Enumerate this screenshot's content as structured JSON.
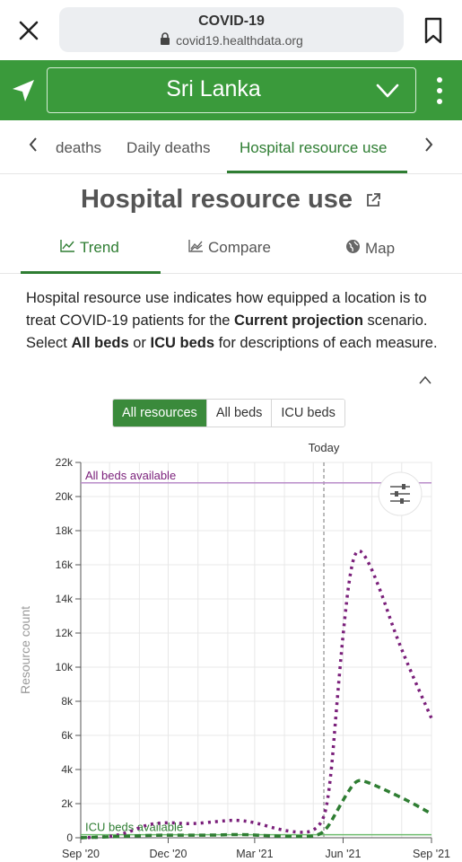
{
  "browser": {
    "title": "COVID-19",
    "url": "covid19.healthdata.org"
  },
  "header": {
    "country": "Sri Lanka"
  },
  "tabs": {
    "items": [
      "deaths",
      "Daily deaths",
      "Hospital resource use"
    ],
    "active": "Hospital resource use"
  },
  "page": {
    "title": "Hospital resource use"
  },
  "subtabs": {
    "trend": "Trend",
    "compare": "Compare",
    "map": "Map"
  },
  "description": {
    "part1": "Hospital resource use indicates how equipped a location is to treat COVID-19 patients for the ",
    "bold1": "Current projection",
    "part2": " scenario. Select ",
    "bold2": "All beds",
    "part3": " or ",
    "bold3": "ICU beds",
    "part4": " for descriptions of each measure."
  },
  "filters": {
    "options": [
      "All resources",
      "All beds",
      "ICU beds"
    ],
    "selected": "All resources"
  },
  "colors": {
    "brand_green": "#3a9a3b",
    "all_beds": "#7a1f7a",
    "icu_beds": "#2e7d32",
    "all_beds_line": "#b98cc9",
    "icu_line": "#6dbb6d"
  },
  "chart_data": {
    "type": "line",
    "ylabel": "Resource count",
    "today_label": "Today",
    "x_ticks": [
      "Sep '20",
      "Dec '20",
      "Mar '21",
      "Jun '21",
      "Sep '21"
    ],
    "x_tick_dates": [
      "2020-09-01",
      "2020-12-01",
      "2021-03-01",
      "2021-06-01",
      "2021-09-01"
    ],
    "today": "2021-05-12",
    "ylim": [
      0,
      22000
    ],
    "y_ticks": [
      0,
      2000,
      4000,
      6000,
      8000,
      10000,
      12000,
      14000,
      16000,
      18000,
      20000,
      22000
    ],
    "y_tick_labels": [
      "0",
      "2k",
      "4k",
      "6k",
      "8k",
      "10k",
      "12k",
      "14k",
      "16k",
      "18k",
      "20k",
      "22k"
    ],
    "grid": true,
    "capacity_lines": [
      {
        "label": "All beds available",
        "value": 20800
      },
      {
        "label": "ICU beds available",
        "value": 180
      }
    ],
    "series": [
      {
        "style": "dotted",
        "points": [
          [
            "2020-09-01",
            0
          ],
          [
            "2020-10-01",
            50
          ],
          [
            "2020-10-20",
            300
          ],
          [
            "2020-11-10",
            800
          ],
          [
            "2020-12-01",
            900
          ],
          [
            "2020-12-25",
            800
          ],
          [
            "2021-01-20",
            950
          ],
          [
            "2021-02-10",
            1050
          ],
          [
            "2021-03-01",
            900
          ],
          [
            "2021-03-25",
            500
          ],
          [
            "2021-04-15",
            300
          ],
          [
            "2021-04-30",
            350
          ],
          [
            "2021-05-10",
            900
          ],
          [
            "2021-05-15",
            1800
          ],
          [
            "2021-05-20",
            4000
          ],
          [
            "2021-05-25",
            7500
          ],
          [
            "2021-06-01",
            12000
          ],
          [
            "2021-06-08",
            15500
          ],
          [
            "2021-06-15",
            17000
          ],
          [
            "2021-06-25",
            16500
          ],
          [
            "2021-07-10",
            14500
          ],
          [
            "2021-07-25",
            12000
          ],
          [
            "2021-08-10",
            9800
          ],
          [
            "2021-09-01",
            7000
          ]
        ]
      },
      {
        "style": "dashed",
        "points": [
          [
            "2020-09-01",
            0
          ],
          [
            "2020-10-15",
            80
          ],
          [
            "2020-11-15",
            150
          ],
          [
            "2020-12-15",
            150
          ],
          [
            "2021-01-15",
            150
          ],
          [
            "2021-02-15",
            200
          ],
          [
            "2021-03-15",
            120
          ],
          [
            "2021-04-15",
            50
          ],
          [
            "2021-05-05",
            100
          ],
          [
            "2021-05-15",
            500
          ],
          [
            "2021-05-25",
            1500
          ],
          [
            "2021-06-05",
            2600
          ],
          [
            "2021-06-15",
            3400
          ],
          [
            "2021-06-25",
            3300
          ],
          [
            "2021-07-15",
            2800
          ],
          [
            "2021-08-10",
            2100
          ],
          [
            "2021-09-01",
            1400
          ]
        ]
      }
    ]
  }
}
